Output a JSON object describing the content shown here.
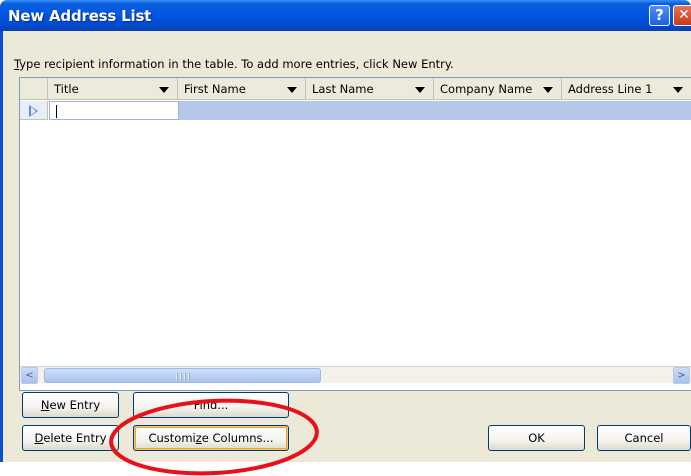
{
  "window": {
    "title": "New Address List",
    "help_icon": "question-mark-icon",
    "help_glyph": "?",
    "close_icon": "close-icon",
    "close_glyph": "✕"
  },
  "instructions": {
    "underlined_letter": "T",
    "text": "ype recipient information in the table.  To add more entries, click New Entry."
  },
  "grid": {
    "columns": [
      {
        "label": "Title"
      },
      {
        "label": "First Name"
      },
      {
        "label": "Last Name"
      },
      {
        "label": "Company Name"
      },
      {
        "label": "Address Line 1"
      }
    ],
    "row_indicator_icon": "current-row-arrow-icon"
  },
  "scrollbar": {
    "left_glyph": "<",
    "right_glyph": ">",
    "left_icon": "scroll-left-icon",
    "right_icon": "scroll-right-icon"
  },
  "buttons": {
    "new_entry": {
      "underlined": "N",
      "rest": "ew Entry"
    },
    "find": {
      "label": "Find..."
    },
    "delete_entry": {
      "underlined": "D",
      "rest": "elete Entry"
    },
    "customize_columns": {
      "before": "Customi",
      "underlined": "z",
      "after": "e Columns..."
    },
    "ok": {
      "label": "OK"
    },
    "cancel": {
      "label": "Cancel"
    }
  },
  "colors": {
    "title_bar": "#0055e3",
    "dialog_face": "#ece9d8",
    "selected_row": "#b6c8ea",
    "annotation": "#e8101a"
  }
}
